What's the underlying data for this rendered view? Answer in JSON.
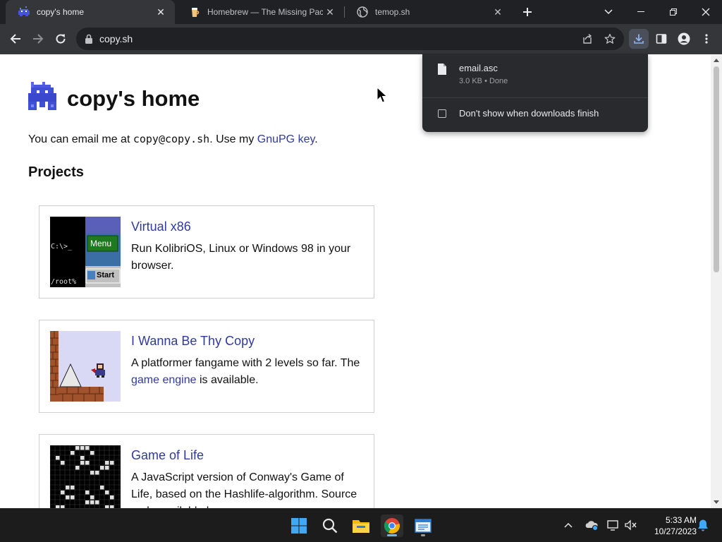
{
  "browser": {
    "tabs": [
      {
        "title": "copy's home",
        "active": true
      },
      {
        "title": "Homebrew — The Missing Package Manager for macOS (or Linux)",
        "active": false
      },
      {
        "title": "temop.sh",
        "active": false
      }
    ],
    "address": "copy.sh"
  },
  "downloads": {
    "file_name": "email.asc",
    "file_meta": "3.0 KB • Done",
    "dont_show_label": "Don't show when downloads finish"
  },
  "page": {
    "heading": "copy's home",
    "intro": {
      "before": "You can email me at ",
      "email": "copy@copy.sh",
      "middle": ". Use my ",
      "key_link": "GnuPG key",
      "after": "."
    },
    "projects_heading": "Projects",
    "projects": [
      {
        "title": "Virtual x86",
        "description": "Run KolibriOS, Linux or Windows 98 in your browser.",
        "thumb": {
          "prompt": "C:\\>_",
          "root": "/root%",
          "menu": "Menu",
          "start": "Start"
        }
      },
      {
        "title": "I Wanna Be Thy Copy",
        "description_before": "A platformer fangame with 2 levels so far. The ",
        "description_link": "game engine",
        "description_after": " is available."
      },
      {
        "title": "Game of Life",
        "description": "A JavaScript version of Conway's Game of Life, based on the Hashlife-algorithm. Source code available here."
      }
    ]
  },
  "taskbar": {
    "apps": [
      "windows-start",
      "search",
      "file-explorer",
      "chrome",
      "notepad"
    ],
    "time": "5:33 AM",
    "date": "10/27/2023"
  },
  "colors": {
    "tabstrip": "#202124",
    "toolbar": "#35363a",
    "link": "#2f3aa0",
    "logo": "#3f4fd6",
    "taskbar": "#1c1c1c"
  }
}
